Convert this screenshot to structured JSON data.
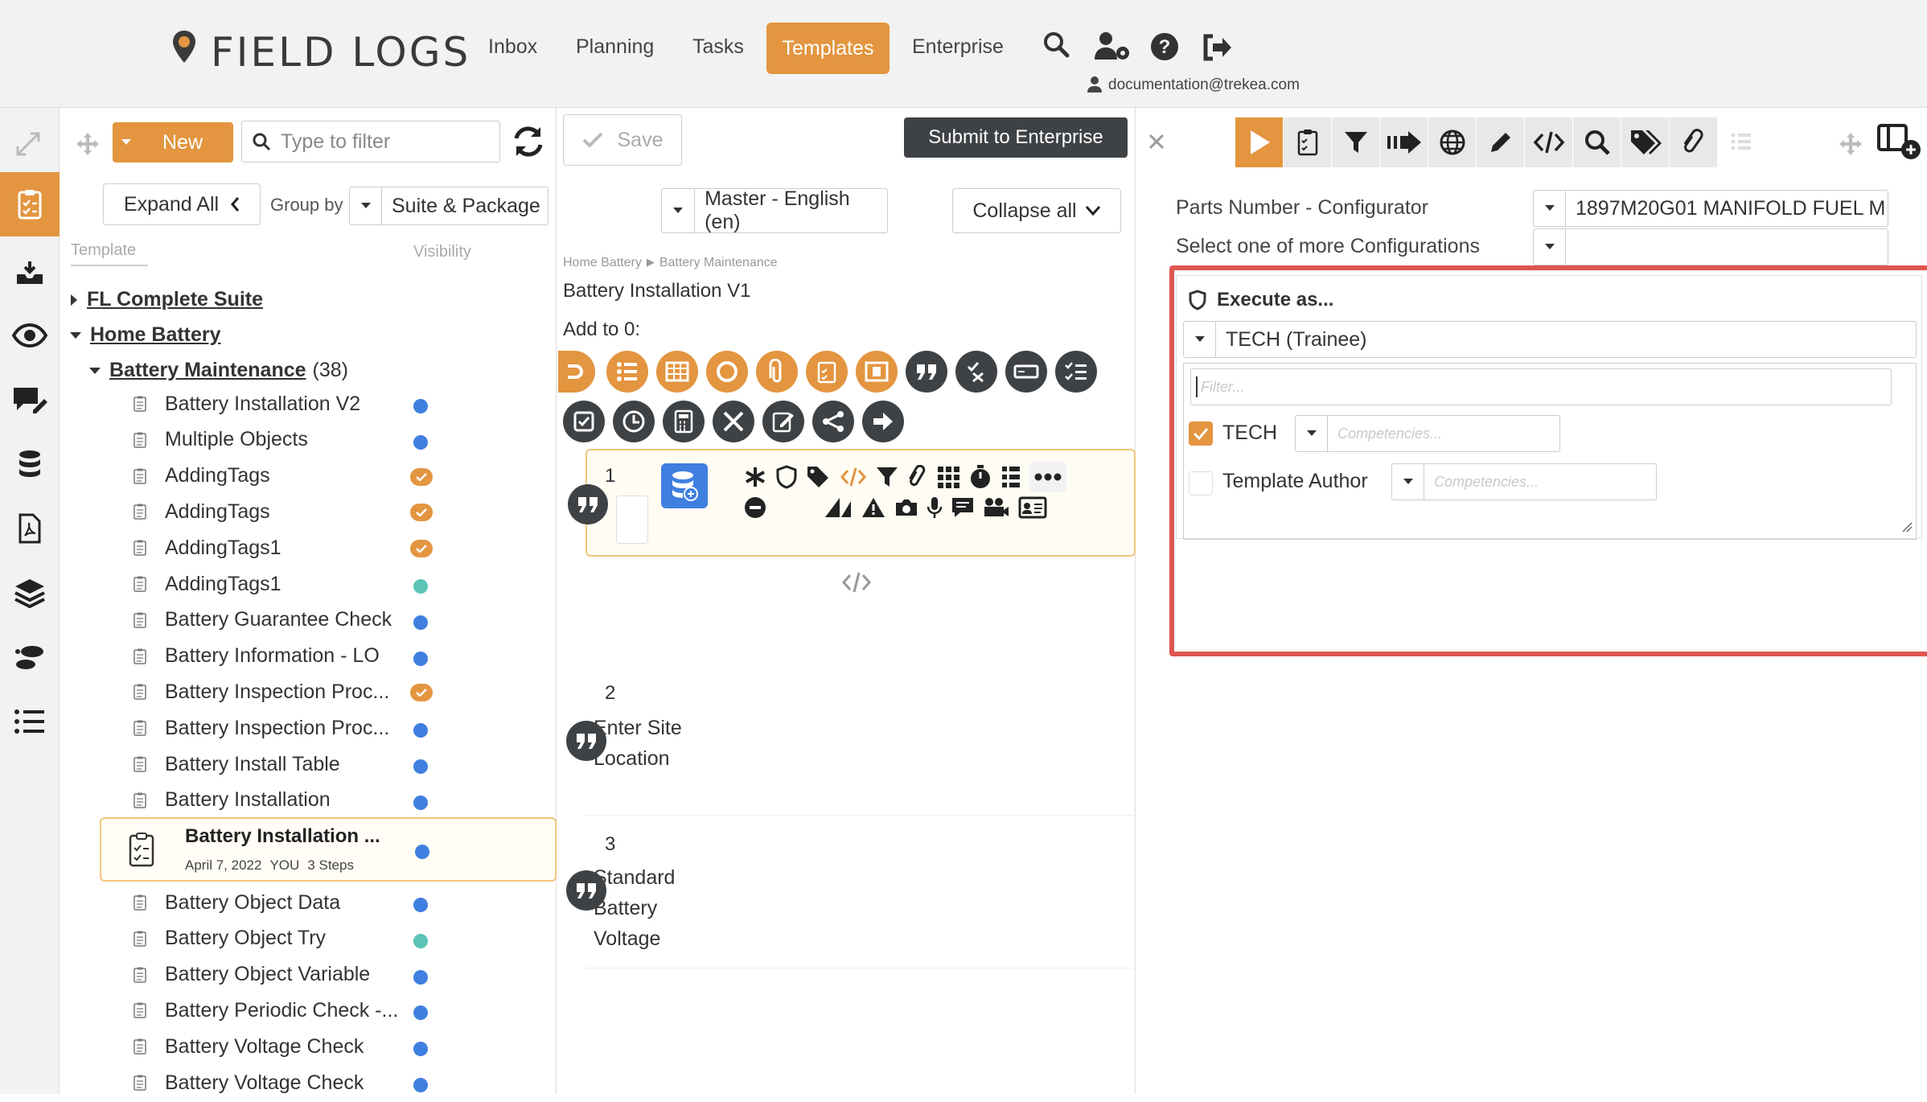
{
  "header": {
    "logo": "FIELD LOGS",
    "nav": [
      "Inbox",
      "Planning",
      "Tasks",
      "Templates",
      "Enterprise"
    ],
    "active_nav": "Templates",
    "user_email": "documentation@trekea.com",
    "accent_color": "#e3953f"
  },
  "toolbar": {
    "new_label": "New",
    "filter_placeholder": "Type to filter",
    "save_label": "Save",
    "submit_label": "Submit to Enterprise"
  },
  "tree": {
    "expand_all_label": "Expand All",
    "group_by_label": "Group by",
    "group_by_value": "Suite & Package",
    "col_template": "Template",
    "col_visibility": "Visibility",
    "suites": [
      {
        "label": "FL Complete Suite"
      },
      {
        "label": "Home Battery"
      }
    ],
    "package": {
      "label": "Battery Maintenance",
      "count": "(38)"
    },
    "items": [
      {
        "label": "Battery Installation V2",
        "status": "blue"
      },
      {
        "label": "Multiple Objects",
        "status": "blue"
      },
      {
        "label": "AddingTags",
        "status": "check"
      },
      {
        "label": "AddingTags",
        "status": "check"
      },
      {
        "label": "AddingTags1",
        "status": "check"
      },
      {
        "label": "AddingTags1",
        "status": "teal"
      },
      {
        "label": "Battery Guarantee Check",
        "status": "blue"
      },
      {
        "label": "Battery Information - LO",
        "status": "blue"
      },
      {
        "label": "Battery Inspection Proc...",
        "status": "check"
      },
      {
        "label": "Battery Inspection Proc...",
        "status": "blue"
      },
      {
        "label": "Battery Install Table",
        "status": "blue"
      },
      {
        "label": "Battery Installation",
        "status": "blue"
      }
    ],
    "selected": {
      "label": "Battery Installation ...",
      "date": "April 7, 2022",
      "author": "YOU",
      "steps": "3 Steps",
      "status": "blue"
    },
    "items_after": [
      {
        "label": "Battery Object Data",
        "status": "blue"
      },
      {
        "label": "Battery Object Try",
        "status": "teal"
      },
      {
        "label": "Battery Object Variable",
        "status": "blue"
      },
      {
        "label": "Battery Periodic Check -...",
        "status": "blue"
      },
      {
        "label": "Battery Voltage Check",
        "status": "blue"
      },
      {
        "label": "Battery Voltage Check",
        "status": "blue"
      }
    ]
  },
  "editor": {
    "language": "Master - English (en)",
    "collapse_label": "Collapse all",
    "breadcrumb": [
      "Home Battery",
      "Battery Maintenance"
    ],
    "title": "Battery Installation V1",
    "add_to_label": "Add to 0:",
    "steps": [
      {
        "number": "1",
        "text": ""
      },
      {
        "number": "2",
        "text": "Enter Site Location"
      },
      {
        "number": "3",
        "text": "Standard Battery Voltage"
      }
    ]
  },
  "config": {
    "parts_label": "Parts Number - Configurator",
    "parts_value": "1897M20G01 MANIFOLD FUEL M",
    "configs_label": "Select one of more Configurations",
    "configs_value": "",
    "execute_label": "Execute as...",
    "execute_value": "TECH (Trainee)",
    "filter_placeholder": "Filter...",
    "roles": [
      {
        "label": "TECH",
        "checked": true,
        "placeholder": "Competencies..."
      },
      {
        "label": "Template Author",
        "checked": false,
        "placeholder": "Competencies..."
      }
    ],
    "highlight_color": "#e0554f"
  }
}
